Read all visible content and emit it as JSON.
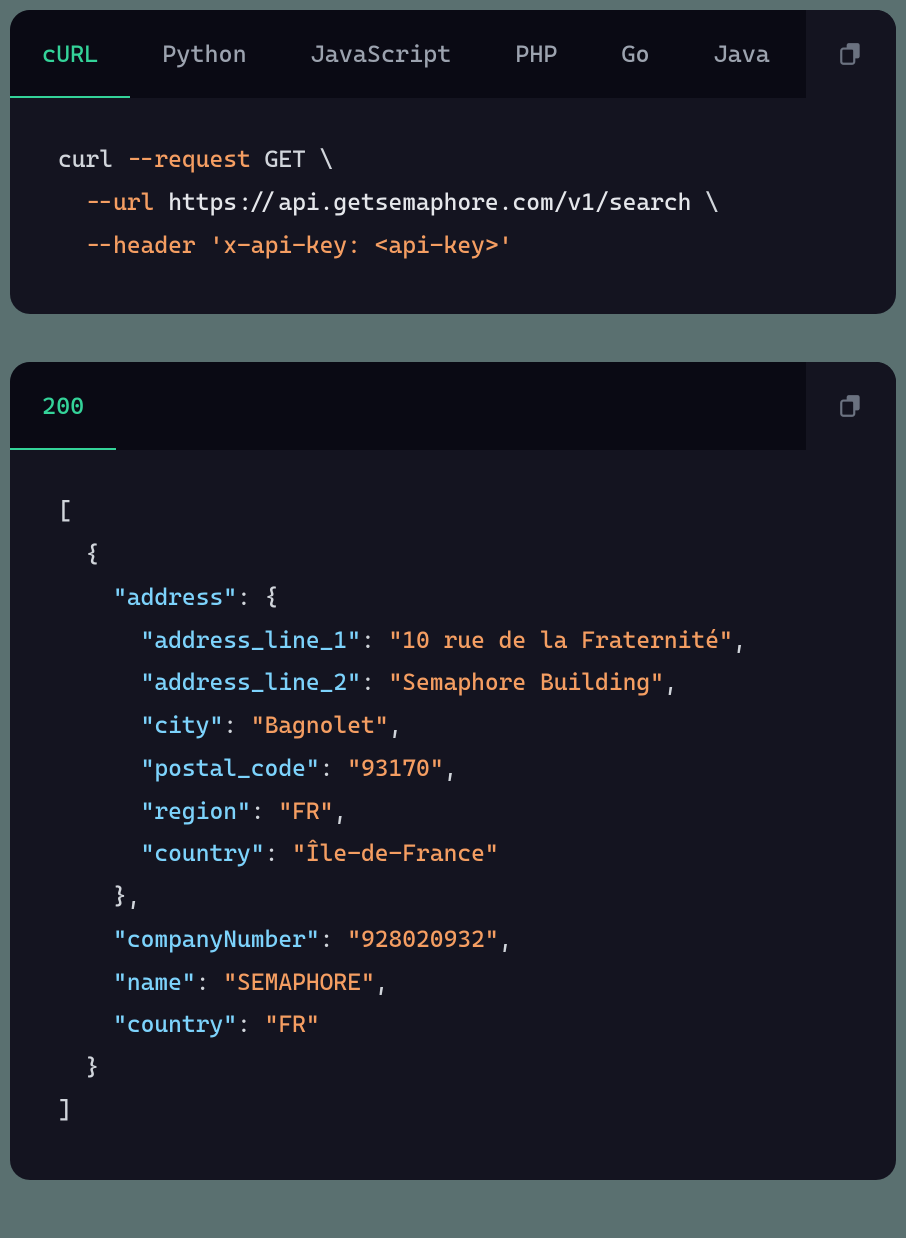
{
  "panel1": {
    "tabs": [
      "cURL",
      "Python",
      "JavaScript",
      "PHP",
      "Go",
      "Java"
    ],
    "active_tab": 0,
    "code": {
      "cmd": "curl",
      "flag_request": "--request",
      "method": "GET",
      "backslash": "\\",
      "flag_url": "--url",
      "url": "https://api.getsemaphore.com/v1/search",
      "flag_header": "--header",
      "header_value": "'x-api-key: <api-key>'"
    }
  },
  "panel2": {
    "tabs": [
      "200"
    ],
    "active_tab": 0,
    "json": {
      "open_bracket": "[",
      "open_brace": "{",
      "k_address": "\"address\"",
      "colon": ":",
      "brace_open": "{",
      "k_addr1": "\"address_line_1\"",
      "v_addr1": "\"10 rue de la Fraternité\"",
      "comma": ",",
      "k_addr2": "\"address_line_2\"",
      "v_addr2": "\"Semaphore Building\"",
      "k_city": "\"city\"",
      "v_city": "\"Bagnolet\"",
      "k_postal": "\"postal_code\"",
      "v_postal": "\"93170\"",
      "k_region": "\"region\"",
      "v_region": "\"FR\"",
      "k_country": "\"country\"",
      "v_country": "\"Île-de-France\"",
      "brace_close": "}",
      "k_company": "\"companyNumber\"",
      "v_company": "\"928020932\"",
      "k_name": "\"name\"",
      "v_name": "\"SEMAPHORE\"",
      "k_country2": "\"country\"",
      "v_country2": "\"FR\"",
      "close_brace": "}",
      "close_bracket": "]"
    }
  }
}
